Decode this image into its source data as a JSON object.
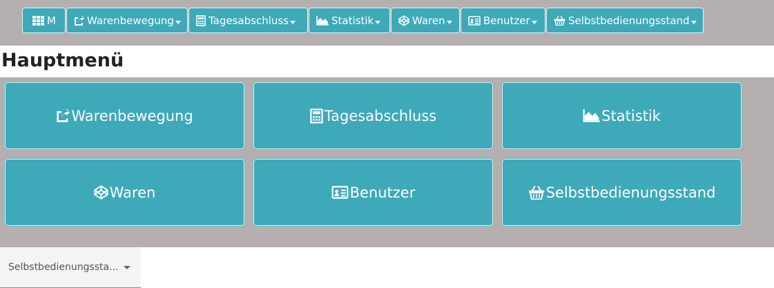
{
  "nav": {
    "home_label": "M",
    "items": [
      {
        "label": "Warenbewegung",
        "icon": "share-square-icon"
      },
      {
        "label": "Tagesabschluss",
        "icon": "calculator-icon"
      },
      {
        "label": "Statistik",
        "icon": "area-chart-icon"
      },
      {
        "label": "Waren",
        "icon": "codepen-icon"
      },
      {
        "label": "Benutzer",
        "icon": "id-card-icon"
      },
      {
        "label": "Selbstbedienungsstand",
        "icon": "shopping-basket-icon"
      }
    ]
  },
  "page_title": "Hauptmenü",
  "tiles": [
    {
      "label": "Warenbewegung",
      "icon": "share-square-icon"
    },
    {
      "label": "Tagesabschluss",
      "icon": "calculator-icon"
    },
    {
      "label": "Statistik",
      "icon": "area-chart-icon"
    },
    {
      "label": "Waren",
      "icon": "codepen-icon"
    },
    {
      "label": "Benutzer",
      "icon": "id-card-icon"
    },
    {
      "label": "Selbstbedienungsstand",
      "icon": "shopping-basket-icon"
    }
  ],
  "select": {
    "value": "Selbstbedienungssta..."
  },
  "colors": {
    "accent": "#3ea9b9",
    "background": "#b5afaf"
  }
}
